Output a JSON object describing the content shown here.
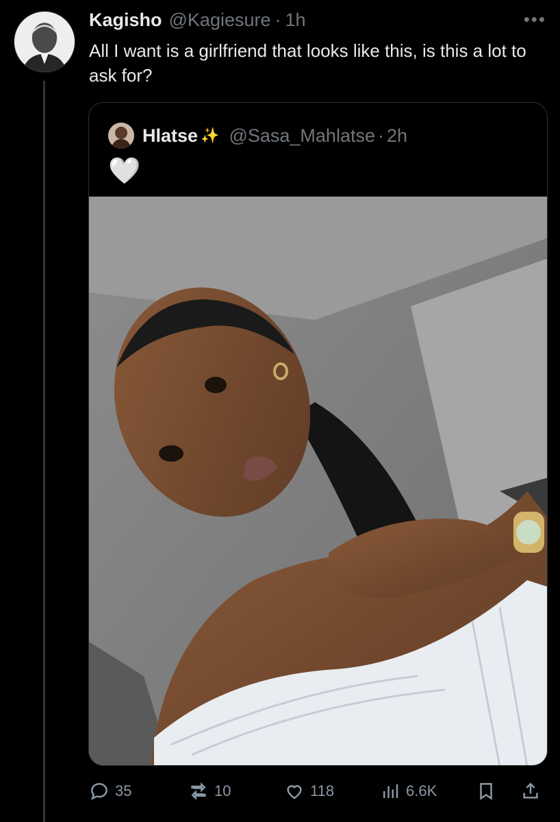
{
  "tweet": {
    "author_name": "Kagisho",
    "author_handle": "@Kagiesure",
    "separator": "·",
    "time": "1h",
    "more_icon": "more-horizontal-icon",
    "text": "All I want is a girlfriend that looks like this, is this a lot to ask for?"
  },
  "quoted": {
    "author_name": "Hlatse",
    "sparkle": "✨",
    "author_handle": "@Sasa_Mahlatse",
    "separator": "·",
    "time": "2h",
    "text": "🤍"
  },
  "actions": {
    "replies": "35",
    "reposts": "10",
    "likes": "118",
    "views": "6.6K"
  },
  "colors": {
    "background": "#000000",
    "text": "#e7e9ea",
    "muted": "#71767b",
    "border": "#2f3336"
  }
}
